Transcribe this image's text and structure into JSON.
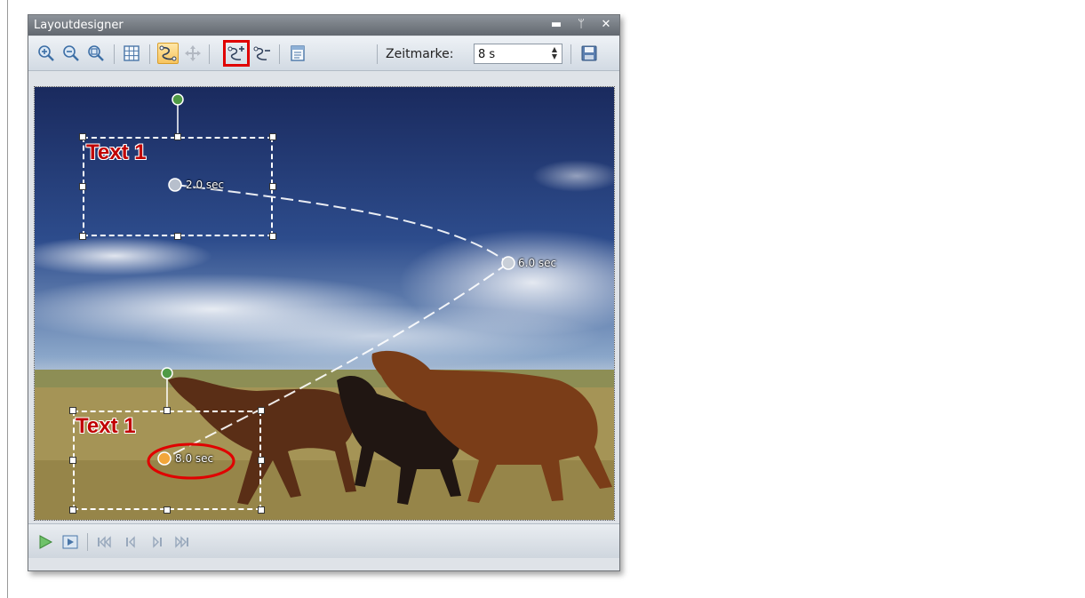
{
  "window": {
    "title": "Layoutdesigner",
    "controls": [
      "minimize-icon",
      "pin-icon",
      "close-icon"
    ]
  },
  "toolbar": {
    "buttons": [
      "zoom-in-icon",
      "zoom-out-icon",
      "zoom-fit-icon",
      "grid-icon",
      "motion-path-icon",
      "move-icon",
      "add-keyframe-icon",
      "remove-keyframe-icon",
      "properties-icon"
    ],
    "active_button": "motion-path-icon",
    "highlighted_button": "add-keyframe-icon",
    "zeitmarke_label": "Zeitmarke:",
    "zeitmarke_value": "8 s",
    "save_icon": "save-icon"
  },
  "canvas": {
    "text_objects": [
      {
        "text": "Text 1",
        "keyframe_label": "2.0 sec"
      },
      {
        "text": "Text 1",
        "keyframe_label": "8.0 sec"
      }
    ],
    "path_keyframes": [
      {
        "label": "6.0 sec"
      }
    ],
    "colors": {
      "highlight": "#e00000",
      "text": "#c00000",
      "rotation_handle": "#4f9a45",
      "active_keyframe": "#f2a63a"
    }
  },
  "playback": {
    "buttons": [
      "play-icon",
      "preview-icon",
      "skip-to-start-icon",
      "previous-icon",
      "next-icon",
      "skip-to-end-icon"
    ]
  }
}
